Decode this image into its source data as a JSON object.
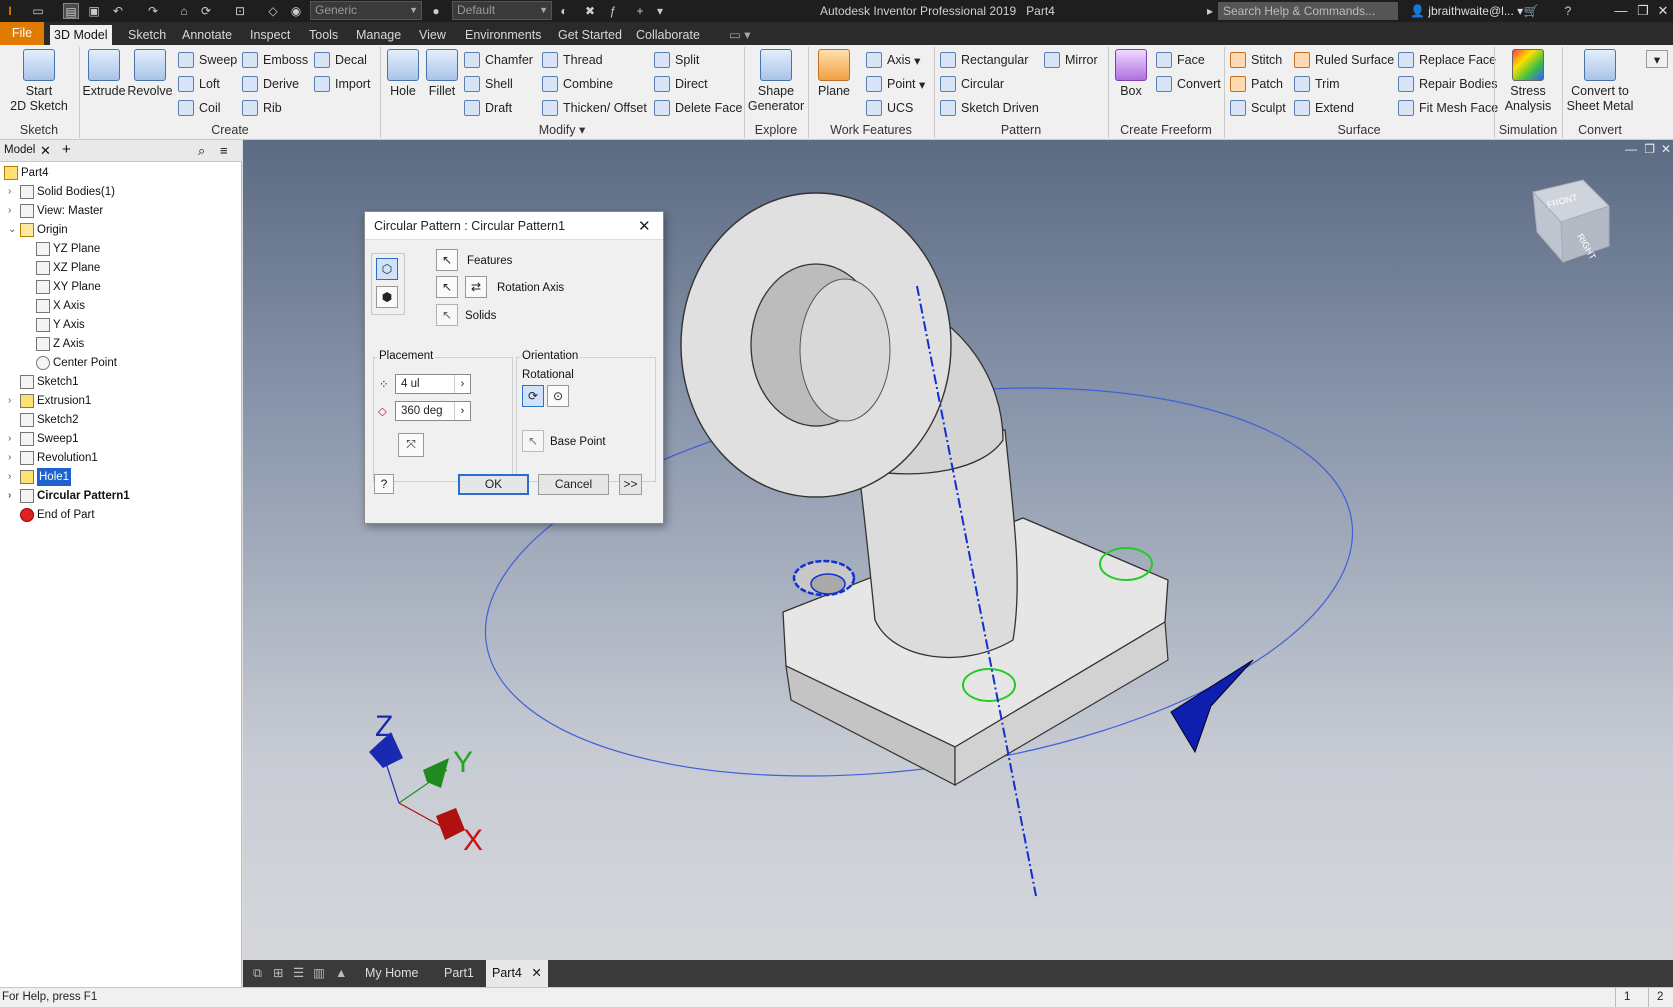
{
  "titlebar": {
    "appearance_combo": "Generic",
    "material_combo": "Default",
    "app_title": "Autodesk Inventor Professional 2019",
    "doc_title": "Part4",
    "search_placeholder": "Search Help & Commands...",
    "user": "jbraithwaite@l..."
  },
  "menu_tabs": [
    "File",
    "3D Model",
    "Sketch",
    "Annotate",
    "Inspect",
    "Tools",
    "Manage",
    "View",
    "Environments",
    "Get Started",
    "Collaborate"
  ],
  "ribbon": {
    "sketch": {
      "start_2d_sketch": "Start\n2D Sketch",
      "group": "Sketch"
    },
    "create": {
      "extrude": "Extrude",
      "revolve": "Revolve",
      "sweep": "Sweep",
      "loft": "Loft",
      "coil": "Coil",
      "emboss": "Emboss",
      "derive": "Derive",
      "rib": "Rib",
      "decal": "Decal",
      "import": "Import",
      "group": "Create"
    },
    "modify": {
      "hole": "Hole",
      "fillet": "Fillet",
      "chamfer": "Chamfer",
      "shell": "Shell",
      "draft": "Draft",
      "thread": "Thread",
      "combine": "Combine",
      "thicken": "Thicken/ Offset",
      "split": "Split",
      "direct": "Direct",
      "delete_face": "Delete Face",
      "group": "Modify"
    },
    "explore": {
      "shape_generator": "Shape\nGenerator",
      "group": "Explore"
    },
    "work_features": {
      "plane": "Plane",
      "axis": "Axis",
      "point": "Point",
      "ucs": "UCS",
      "group": "Work Features"
    },
    "pattern": {
      "rectangular": "Rectangular",
      "circular": "Circular",
      "sketch_driven": "Sketch Driven",
      "mirror": "Mirror",
      "group": "Pattern"
    },
    "freeform": {
      "box": "Box",
      "face": "Face",
      "convert": "Convert",
      "group": "Create Freeform"
    },
    "surface": {
      "stitch": "Stitch",
      "patch": "Patch",
      "sculpt": "Sculpt",
      "ruled_surface": "Ruled Surface",
      "trim": "Trim",
      "extend": "Extend",
      "replace_face": "Replace Face",
      "repair_bodies": "Repair Bodies",
      "fit_mesh_face": "Fit Mesh Face",
      "group": "Surface"
    },
    "simulation": {
      "stress_analysis": "Stress\nAnalysis",
      "group": "Simulation"
    },
    "convert": {
      "convert_sheet_metal": "Convert to\nSheet Metal",
      "group": "Convert"
    }
  },
  "browser": {
    "tab": "Model",
    "nodes": [
      {
        "label": "Part4"
      },
      {
        "label": "Solid Bodies(1)"
      },
      {
        "label": "View: Master"
      },
      {
        "label": "Origin"
      },
      {
        "label": "YZ Plane"
      },
      {
        "label": "XZ Plane"
      },
      {
        "label": "XY Plane"
      },
      {
        "label": "X Axis"
      },
      {
        "label": "Y Axis"
      },
      {
        "label": "Z Axis"
      },
      {
        "label": "Center Point"
      },
      {
        "label": "Sketch1"
      },
      {
        "label": "Extrusion1"
      },
      {
        "label": "Sketch2"
      },
      {
        "label": "Sweep1"
      },
      {
        "label": "Revolution1"
      },
      {
        "label": "Hole1"
      },
      {
        "label": "Circular Pattern1"
      },
      {
        "label": "End of Part"
      }
    ]
  },
  "dialog": {
    "title": "Circular Pattern : Circular Pattern1",
    "features": "Features",
    "rotation_axis": "Rotation Axis",
    "solids": "Solids",
    "placement": "Placement",
    "count": "4 ul",
    "angle": "360 deg",
    "orientation": "Orientation",
    "rotational": "Rotational",
    "base_point": "Base Point",
    "ok": "OK",
    "cancel": "Cancel",
    "more": ">>"
  },
  "axes": {
    "x": "X",
    "y": "Y",
    "z": "Z"
  },
  "viewcube": {
    "front": "FRONT",
    "right": "RIGHT"
  },
  "doc_tabs": [
    "My Home",
    "Part1",
    "Part4"
  ],
  "status": {
    "help": "For Help, press F1",
    "num1": "1",
    "num2": "2"
  },
  "colors": {
    "accent": "#e07a00",
    "axis_blue": "#1030d0",
    "selection_green": "#22cc22"
  }
}
